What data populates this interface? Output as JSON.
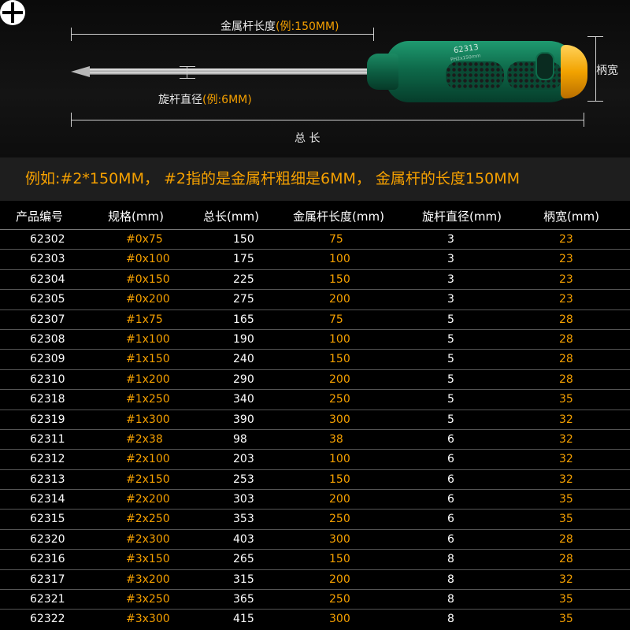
{
  "diagram": {
    "metal_rod_length_label": "金属杆长度",
    "metal_rod_length_example": "(例:150MM)",
    "rod_diameter_label": "旋杆直径",
    "rod_diameter_example": "(例:6MM)",
    "total_length_label": "总 长",
    "handle_width_label": "柄宽",
    "handle_model_text": "62313",
    "handle_model_subtext": "PH2x150mm"
  },
  "example_text": "例如:#2*150MM， #2指的是金属杆粗细是6MM， 金属杆的长度150MM",
  "colors": {
    "accent": "#f5a000",
    "background": "#000000",
    "handle_green": "#0e6a4a",
    "endcap_yellow": "#f2a300"
  },
  "table": {
    "headers": [
      "产品编号",
      "规格(mm)",
      "总长(mm)",
      "金属杆长度(mm)",
      "旋杆直径(mm)",
      "柄宽(mm)"
    ],
    "rows": [
      [
        "62302",
        "#0x75",
        "150",
        "75",
        "3",
        "23"
      ],
      [
        "62303",
        "#0x100",
        "175",
        "100",
        "3",
        "23"
      ],
      [
        "62304",
        "#0x150",
        "225",
        "150",
        "3",
        "23"
      ],
      [
        "62305",
        "#0x200",
        "275",
        "200",
        "3",
        "23"
      ],
      [
        "62307",
        "#1x75",
        "165",
        "75",
        "5",
        "28"
      ],
      [
        "62308",
        "#1x100",
        "190",
        "100",
        "5",
        "28"
      ],
      [
        "62309",
        "#1x150",
        "240",
        "150",
        "5",
        "28"
      ],
      [
        "62310",
        "#1x200",
        "290",
        "200",
        "5",
        "28"
      ],
      [
        "62318",
        "#1x250",
        "340",
        "250",
        "5",
        "35"
      ],
      [
        "62319",
        "#1x300",
        "390",
        "300",
        "5",
        "32"
      ],
      [
        "62311",
        "#2x38",
        "98",
        "38",
        "6",
        "32"
      ],
      [
        "62312",
        "#2x100",
        "203",
        "100",
        "6",
        "32"
      ],
      [
        "62313",
        "#2x150",
        "253",
        "150",
        "6",
        "32"
      ],
      [
        "62314",
        "#2x200",
        "303",
        "200",
        "6",
        "35"
      ],
      [
        "62315",
        "#2x250",
        "353",
        "250",
        "6",
        "35"
      ],
      [
        "62320",
        "#2x300",
        "403",
        "300",
        "6",
        "28"
      ],
      [
        "62316",
        "#3x150",
        "265",
        "150",
        "8",
        "28"
      ],
      [
        "62317",
        "#3x200",
        "315",
        "200",
        "8",
        "32"
      ],
      [
        "62321",
        "#3x250",
        "365",
        "250",
        "8",
        "35"
      ],
      [
        "62322",
        "#3x300",
        "415",
        "300",
        "8",
        "35"
      ]
    ]
  }
}
